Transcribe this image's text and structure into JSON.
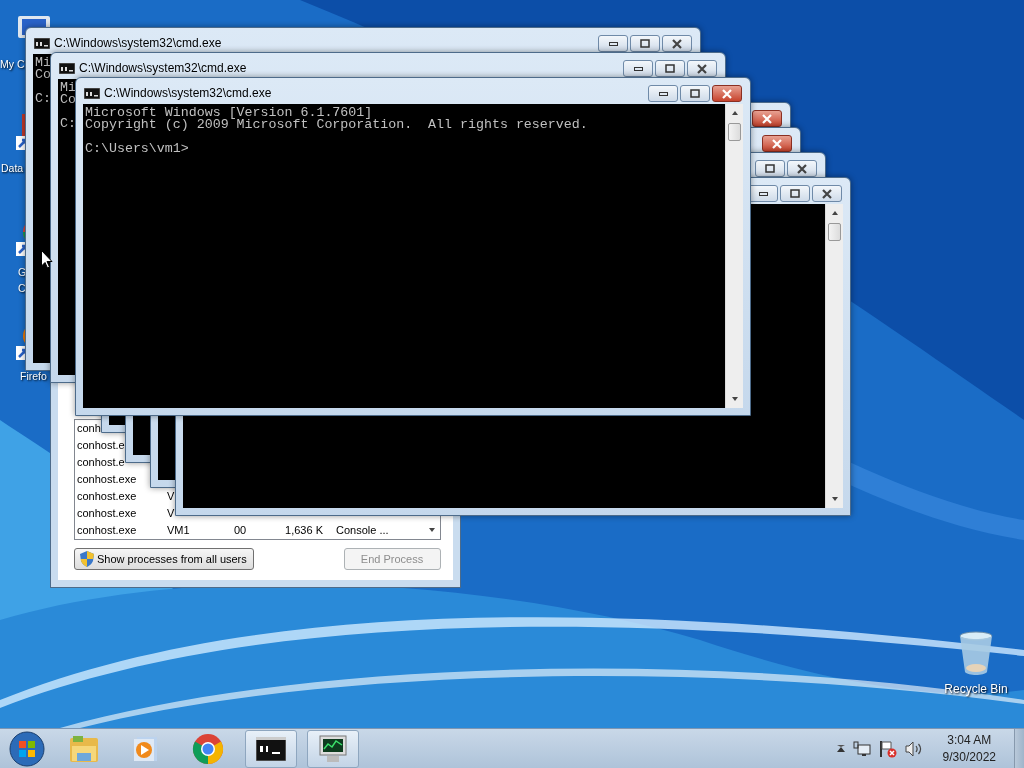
{
  "desktop_icons": [
    {
      "kind": "computer",
      "label_lines": [
        "My C"
      ]
    },
    {
      "kind": "document",
      "label_lines": [
        "Data"
      ]
    },
    {
      "kind": "browser",
      "label_lines": [
        "G",
        "C"
      ]
    },
    {
      "kind": "fox",
      "label_lines": [
        "Firefo"
      ]
    }
  ],
  "recycle_bin": {
    "label": "Recycle Bin"
  },
  "task_manager": {
    "rows": [
      {
        "cells": [
          "conh"
        ]
      },
      {
        "cells": [
          "conhost.e"
        ]
      },
      {
        "cells": [
          "conhost.e"
        ]
      },
      {
        "cells": [
          "conhost.exe"
        ]
      },
      {
        "cells": [
          "conhost.exe",
          "V"
        ]
      },
      {
        "cells": [
          "conhost.exe",
          "V"
        ]
      },
      {
        "cells": [
          "conhost.exe",
          "VM1",
          "00",
          "1,636 K",
          "Console ..."
        ]
      }
    ],
    "buttons": [
      {
        "kind": "shield",
        "label": "Show processes from all users",
        "disabled": false
      },
      {
        "kind": "plain",
        "label": "End Process",
        "disabled": true
      }
    ]
  },
  "windows": [
    {
      "title": "C:\\Windows\\system32\\cmd.exe",
      "banner": [
        "Mi",
        "Co"
      ],
      "prompt": "C:",
      "buttons": [
        {
          "kind": "minimize",
          "highlighted": false
        },
        {
          "kind": "maximize",
          "highlighted": false
        },
        {
          "kind": "close",
          "highlighted": false
        }
      ]
    },
    {
      "title": "C:\\Windows\\system32\\cmd.exe",
      "banner": [
        "Mi",
        "Co"
      ],
      "prompt": "C:",
      "buttons": [
        {
          "kind": "minimize",
          "highlighted": false
        },
        {
          "kind": "maximize",
          "highlighted": false
        },
        {
          "kind": "close",
          "highlighted": false
        }
      ]
    },
    {
      "buttons": [
        {
          "kind": "close",
          "highlighted": true
        }
      ]
    },
    {
      "buttons": [
        {
          "kind": "close",
          "highlighted": true
        }
      ]
    },
    {
      "buttons": [
        {
          "kind": "maximize",
          "highlighted": false
        },
        {
          "kind": "close",
          "highlighted": false
        }
      ]
    },
    {
      "buttons": [
        {
          "kind": "minimize",
          "highlighted": false
        },
        {
          "kind": "maximize",
          "highlighted": false
        },
        {
          "kind": "close",
          "highlighted": false
        }
      ],
      "scrollbar": true
    },
    {
      "title": "C:\\Windows\\system32\\cmd.exe",
      "banner": [
        "Microsoft Windows [Version 6.1.7601]",
        "Copyright (c) 2009 Microsoft Corporation.  All rights reserved."
      ],
      "prompt": "C:\\Users\\vm1>",
      "buttons": [
        {
          "kind": "minimize",
          "highlighted": false
        },
        {
          "kind": "maximize",
          "highlighted": false
        },
        {
          "kind": "close",
          "highlighted": true
        }
      ],
      "scrollbar": true
    }
  ],
  "taskbar": {
    "items": [
      {
        "kind": "folder",
        "running": false
      },
      {
        "kind": "media",
        "running": false
      },
      {
        "kind": "browser",
        "running": false
      },
      {
        "kind": "terminal",
        "running": true
      },
      {
        "kind": "monitor",
        "running": true
      }
    ],
    "clock": {
      "time": "3:04 AM",
      "date": "9/30/2022"
    }
  }
}
